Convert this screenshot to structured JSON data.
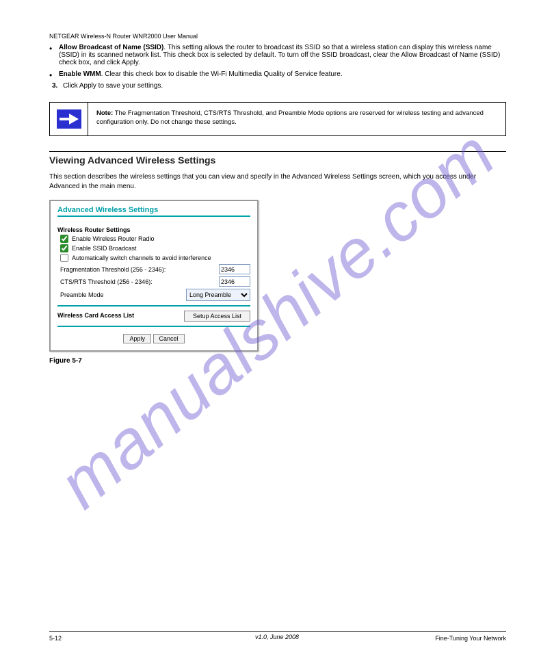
{
  "watermark": "manualshive.com",
  "header_line": "NETGEAR Wireless-N Router WNR2000 User Manual",
  "header_note": "v1.0, June 2008",
  "bullets": [
    {
      "bold": "Allow Broadcast of Name (SSID)",
      "rest": ". This setting allows the router to broadcast its SSID so that a wireless station can display this wireless name (SSID) in its scanned network list. This check box is selected by default. To turn off the SSID broadcast, clear the Allow Broadcast of Name (SSID) check box, and click Apply."
    },
    {
      "bold": "Enable WMM",
      "rest": ". Clear this check box to disable the Wi-Fi Multimedia Quality of Service feature."
    }
  ],
  "last_step": {
    "n": "3.",
    "text": "Click Apply to save your settings."
  },
  "note": {
    "label": "Note:",
    "text": "The Fragmentation Threshold, CTS/RTS Threshold, and Preamble Mode options are reserved for wireless testing and advanced configuration only. Do not change these settings."
  },
  "section_title": "Viewing Advanced Wireless Settings",
  "section_intro": "This section describes the wireless settings that you can view and specify in the Advanced Wireless Settings screen, which you access under Advanced in the main menu.",
  "panel": {
    "title": "Advanced Wireless Settings",
    "group_title": "Wireless Router Settings",
    "checkboxes": [
      {
        "label": "Enable Wireless Router Radio",
        "checked": true
      },
      {
        "label": "Enable SSID Broadcast",
        "checked": true
      },
      {
        "label": "Automatically switch channels to avoid interference",
        "checked": false
      }
    ],
    "frag_label": "Fragmentation Threshold (256 - 2346):",
    "frag_value": "2346",
    "cts_label": "CTS/RTS Threshold (256 - 2346):",
    "cts_value": "2346",
    "preamble_label": "Preamble Mode",
    "preamble_value": "Long Preamble",
    "access_label": "Wireless Card Access List",
    "access_btn": "Setup Access List",
    "apply": "Apply",
    "cancel": "Cancel"
  },
  "figure_label": "Figure 5-7",
  "footer_left": "5-12",
  "footer_right": "Fine-Tuning Your Network"
}
